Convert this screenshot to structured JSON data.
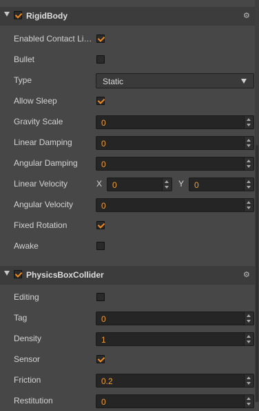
{
  "rigidbody": {
    "title": "RigidBody",
    "enabled": true,
    "rows": {
      "enabled_contact": {
        "label": "Enabled Contact Listener",
        "checked": true
      },
      "bullet": {
        "label": "Bullet",
        "checked": false
      },
      "type": {
        "label": "Type",
        "value": "Static"
      },
      "allow_sleep": {
        "label": "Allow Sleep",
        "checked": true
      },
      "gravity_scale": {
        "label": "Gravity Scale",
        "value": "0"
      },
      "linear_damping": {
        "label": "Linear Damping",
        "value": "0"
      },
      "angular_damping": {
        "label": "Angular Damping",
        "value": "0"
      },
      "linear_velocity": {
        "label": "Linear Velocity",
        "x_label": "X",
        "x": "0",
        "y_label": "Y",
        "y": "0"
      },
      "angular_velocity": {
        "label": "Angular Velocity",
        "value": "0"
      },
      "fixed_rotation": {
        "label": "Fixed Rotation",
        "checked": true
      },
      "awake": {
        "label": "Awake",
        "checked": false
      }
    }
  },
  "collider": {
    "title": "PhysicsBoxCollider",
    "enabled": true,
    "rows": {
      "editing": {
        "label": "Editing",
        "checked": false
      },
      "tag": {
        "label": "Tag",
        "value": "0"
      },
      "density": {
        "label": "Density",
        "value": "1"
      },
      "sensor": {
        "label": "Sensor",
        "checked": true
      },
      "friction": {
        "label": "Friction",
        "value": "0.2"
      },
      "restitution": {
        "label": "Restitution",
        "value": "0"
      }
    }
  },
  "icons": {
    "collapse": "triangle-down",
    "settings": "gear",
    "check": "checkmark"
  },
  "colors": {
    "accent": "#f28a1e",
    "background": "#474747",
    "header": "#3c3c3c",
    "field": "#252525"
  }
}
